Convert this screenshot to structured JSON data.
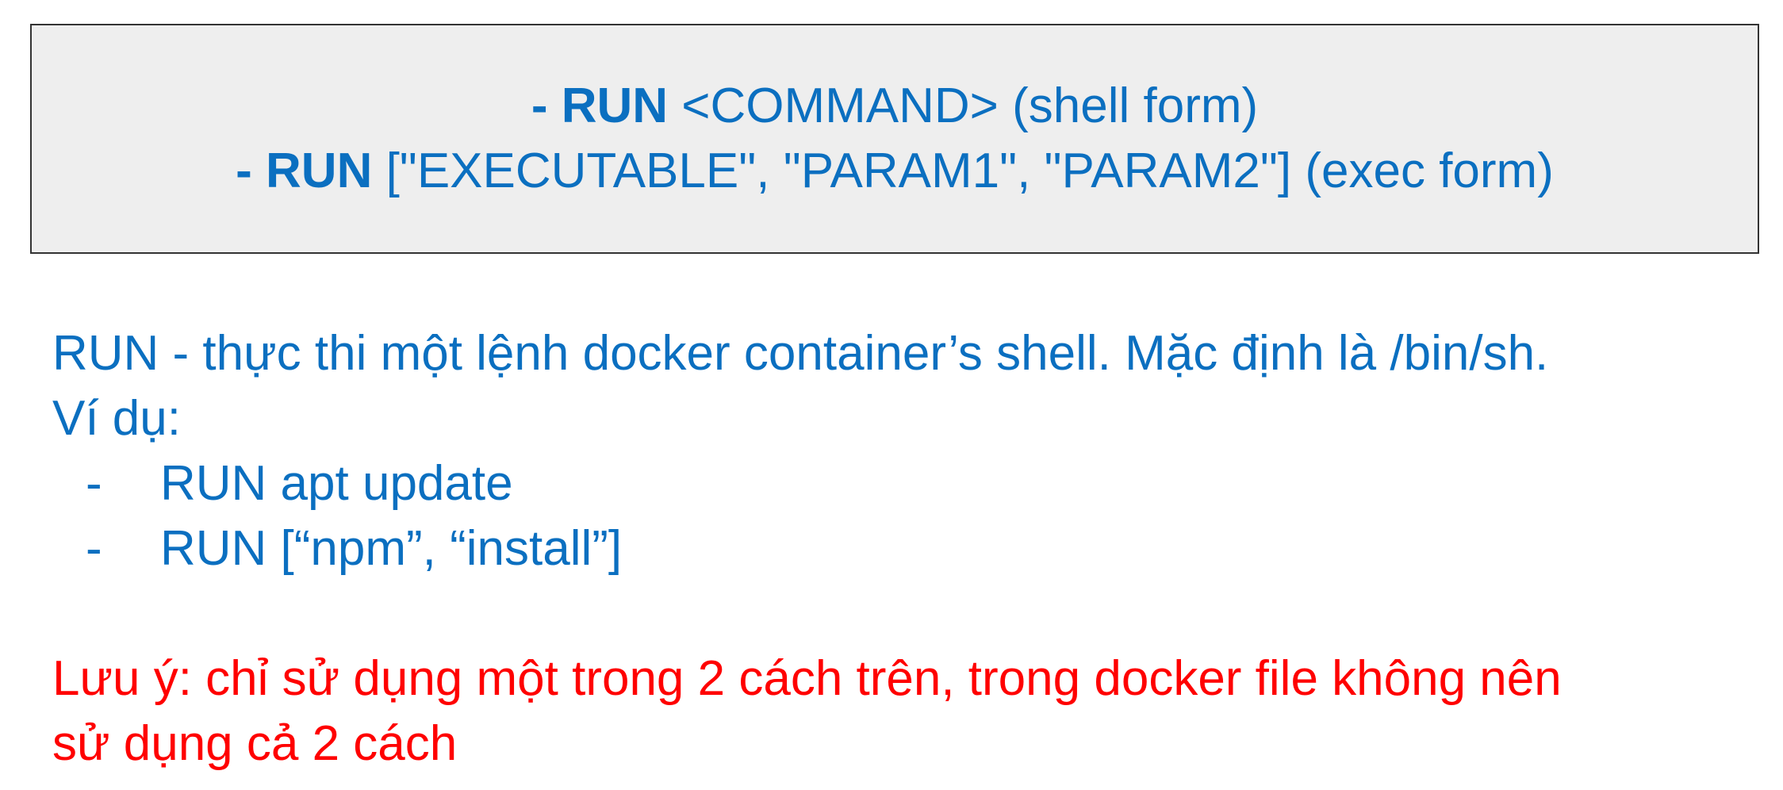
{
  "syntax": {
    "shell_form": {
      "dash": "- ",
      "keyword": "RUN",
      "rest": " <COMMAND> (shell form)"
    },
    "exec_form": {
      "dash": "- ",
      "keyword": "RUN",
      "rest": " [\"EXECUTABLE\", \"PARAM1\", \"PARAM2\"] (exec form)"
    }
  },
  "description": {
    "line1": "RUN - thực thi một lệnh docker container’s shell. Mặc định là /bin/sh.",
    "example_heading": "Ví dụ:",
    "examples": [
      {
        "dash": "-",
        "text": "RUN apt update"
      },
      {
        "dash": "-",
        "text": "RUN [“npm”, “install”]"
      }
    ]
  },
  "note": {
    "line1": "Lưu ý: chỉ sử dụng một trong 2 cách trên, trong docker file không nên",
    "line2": "sử dụng cả 2 cách"
  },
  "colors": {
    "text_blue": "#0b6fc0",
    "note_red": "#ff0000",
    "box_background": "#eeeeee",
    "box_border": "#333333"
  }
}
